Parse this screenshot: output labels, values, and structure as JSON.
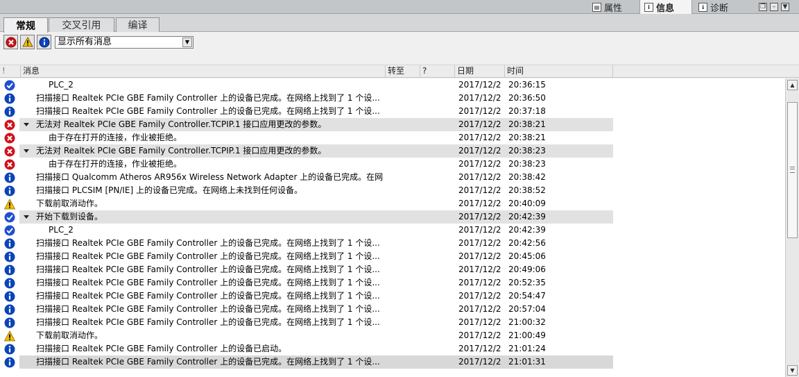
{
  "inspector_tabs": [
    {
      "label": "属性",
      "icon": "properties-icon",
      "active": false
    },
    {
      "label": "信息",
      "icon": "info-icon",
      "active": true
    },
    {
      "label": "诊断",
      "icon": "diagnostics-icon",
      "active": false
    }
  ],
  "sub_tabs": [
    {
      "label": "常规",
      "active": true
    },
    {
      "label": "交叉引用",
      "active": false
    },
    {
      "label": "编译",
      "active": false
    }
  ],
  "filter": {
    "buttons": [
      "error-filter-icon",
      "warning-filter-icon",
      "info-filter-icon"
    ],
    "selected": "显示所有消息"
  },
  "columns": {
    "bang": "!",
    "message": "消息",
    "goto": "转至",
    "help": "?",
    "date": "日期",
    "time": "时间"
  },
  "colors": {
    "info": "#0a44b8",
    "check": "#1f4fd0",
    "error": "#d0111b",
    "warning": "#f4c000",
    "row_group_bg": "#e1e1e1"
  },
  "rows": [
    {
      "icon": "check",
      "indent": 2,
      "expand": false,
      "group": false,
      "message": "PLC_2",
      "date": "2017/12/2",
      "time": "20:36:15"
    },
    {
      "icon": "info",
      "indent": 1,
      "expand": false,
      "group": false,
      "message": "扫描接口 Realtek PCIe GBE Family Controller 上的设备已完成。在网络上找到了 1 个设...",
      "date": "2017/12/2",
      "time": "20:36:50"
    },
    {
      "icon": "info",
      "indent": 1,
      "expand": false,
      "group": false,
      "message": "扫描接口 Realtek PCIe GBE Family Controller 上的设备已完成。在网络上找到了 1 个设...",
      "date": "2017/12/2",
      "time": "20:37:18"
    },
    {
      "icon": "error",
      "indent": 1,
      "expand": true,
      "group": true,
      "message": "无法对 Realtek PCIe GBE Family Controller.TCPIP.1 接口应用更改的参数。",
      "date": "2017/12/2",
      "time": "20:38:21"
    },
    {
      "icon": "error",
      "indent": 2,
      "expand": false,
      "group": false,
      "message": "由于存在打开的连接，作业被拒绝。",
      "date": "2017/12/2",
      "time": "20:38:21"
    },
    {
      "icon": "error",
      "indent": 1,
      "expand": true,
      "group": true,
      "message": "无法对 Realtek PCIe GBE Family Controller.TCPIP.1 接口应用更改的参数。",
      "date": "2017/12/2",
      "time": "20:38:23"
    },
    {
      "icon": "error",
      "indent": 2,
      "expand": false,
      "group": false,
      "message": "由于存在打开的连接，作业被拒绝。",
      "date": "2017/12/2",
      "time": "20:38:23"
    },
    {
      "icon": "info",
      "indent": 1,
      "expand": false,
      "group": false,
      "message": "扫描接口 Qualcomm Atheros AR956x Wireless Network Adapter 上的设备已完成。在网...",
      "date": "2017/12/2",
      "time": "20:38:42"
    },
    {
      "icon": "info",
      "indent": 1,
      "expand": false,
      "group": false,
      "message": "扫描接口 PLCSIM [PN/IE] 上的设备已完成。在网络上未找到任何设备。",
      "date": "2017/12/2",
      "time": "20:38:52"
    },
    {
      "icon": "warning",
      "indent": 1,
      "expand": false,
      "group": false,
      "message": "下载前取消动作。",
      "date": "2017/12/2",
      "time": "20:40:09"
    },
    {
      "icon": "check",
      "indent": 1,
      "expand": true,
      "group": true,
      "message": "开始下载到设备。",
      "date": "2017/12/2",
      "time": "20:42:39"
    },
    {
      "icon": "check",
      "indent": 2,
      "expand": false,
      "group": false,
      "message": "PLC_2",
      "date": "2017/12/2",
      "time": "20:42:39"
    },
    {
      "icon": "info",
      "indent": 1,
      "expand": false,
      "group": false,
      "message": "扫描接口 Realtek PCIe GBE Family Controller 上的设备已完成。在网络上找到了 1 个设...",
      "date": "2017/12/2",
      "time": "20:42:56"
    },
    {
      "icon": "info",
      "indent": 1,
      "expand": false,
      "group": false,
      "message": "扫描接口 Realtek PCIe GBE Family Controller 上的设备已完成。在网络上找到了 1 个设...",
      "date": "2017/12/2",
      "time": "20:45:06"
    },
    {
      "icon": "info",
      "indent": 1,
      "expand": false,
      "group": false,
      "message": "扫描接口 Realtek PCIe GBE Family Controller 上的设备已完成。在网络上找到了 1 个设...",
      "date": "2017/12/2",
      "time": "20:49:06"
    },
    {
      "icon": "info",
      "indent": 1,
      "expand": false,
      "group": false,
      "message": "扫描接口 Realtek PCIe GBE Family Controller 上的设备已完成。在网络上找到了 1 个设...",
      "date": "2017/12/2",
      "time": "20:52:35"
    },
    {
      "icon": "info",
      "indent": 1,
      "expand": false,
      "group": false,
      "message": "扫描接口 Realtek PCIe GBE Family Controller 上的设备已完成。在网络上找到了 1 个设...",
      "date": "2017/12/2",
      "time": "20:54:47"
    },
    {
      "icon": "info",
      "indent": 1,
      "expand": false,
      "group": false,
      "message": "扫描接口 Realtek PCIe GBE Family Controller 上的设备已完成。在网络上找到了 1 个设...",
      "date": "2017/12/2",
      "time": "20:57:04"
    },
    {
      "icon": "info",
      "indent": 1,
      "expand": false,
      "group": false,
      "message": "扫描接口 Realtek PCIe GBE Family Controller 上的设备已完成。在网络上找到了 1 个设...",
      "date": "2017/12/2",
      "time": "21:00:32"
    },
    {
      "icon": "warning",
      "indent": 1,
      "expand": false,
      "group": false,
      "message": "下载前取消动作。",
      "date": "2017/12/2",
      "time": "21:00:49"
    },
    {
      "icon": "info",
      "indent": 1,
      "expand": false,
      "group": false,
      "message": "扫描接口 Realtek PCIe GBE Family Controller 上的设备已启动。",
      "date": "2017/12/2",
      "time": "21:01:24"
    },
    {
      "icon": "info",
      "indent": 1,
      "expand": false,
      "group": false,
      "selected": true,
      "message": "扫描接口 Realtek PCIe GBE Family Controller 上的设备已完成。在网络上找到了 1 个设...",
      "date": "2017/12/2",
      "time": "21:01:31"
    }
  ]
}
